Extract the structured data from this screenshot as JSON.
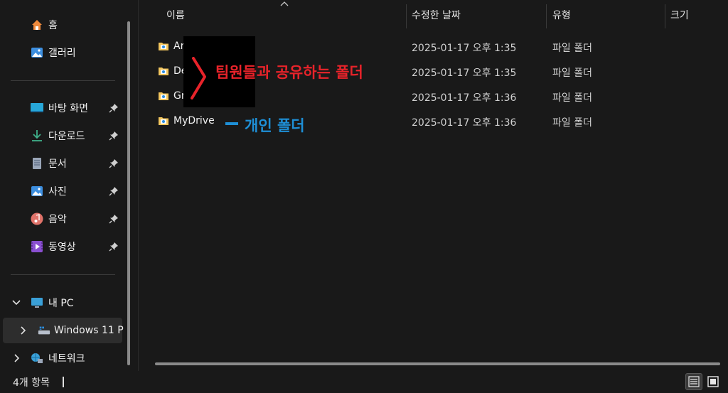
{
  "sidebar": {
    "quick": [
      {
        "label": "홈",
        "icon": "home-icon"
      },
      {
        "label": "갤러리",
        "icon": "gallery-icon"
      }
    ],
    "pinned": [
      {
        "label": "바탕 화면",
        "icon": "desktop-icon"
      },
      {
        "label": "다운로드",
        "icon": "download-icon"
      },
      {
        "label": "문서",
        "icon": "document-icon"
      },
      {
        "label": "사진",
        "icon": "pictures-icon"
      },
      {
        "label": "음악",
        "icon": "music-icon"
      },
      {
        "label": "동영상",
        "icon": "video-icon"
      }
    ],
    "this_pc": "내 PC",
    "drive": "Windows 11 P",
    "network": "네트워크"
  },
  "columns": {
    "name": "이름",
    "date": "수정한 날짜",
    "type": "유형",
    "size": "크기"
  },
  "files": [
    {
      "name": "Ar",
      "date": "2025-01-17 오후 1:35",
      "type": "파일 폴더"
    },
    {
      "name": "De",
      "date": "2025-01-17 오후 1:35",
      "type": "파일 폴더"
    },
    {
      "name": "Gr",
      "date": "2025-01-17 오후 1:36",
      "type": "파일 폴더"
    },
    {
      "name": "MyDrive",
      "date": "2025-01-17 오후 1:36",
      "type": "파일 폴더"
    }
  ],
  "annotations": {
    "shared": "팀원들과 공유하는 폴더",
    "personal": "개인 폴더",
    "shared_color": "#e8232a",
    "personal_color": "#1e8fd6"
  },
  "status": {
    "item_count": "4개 항목"
  }
}
